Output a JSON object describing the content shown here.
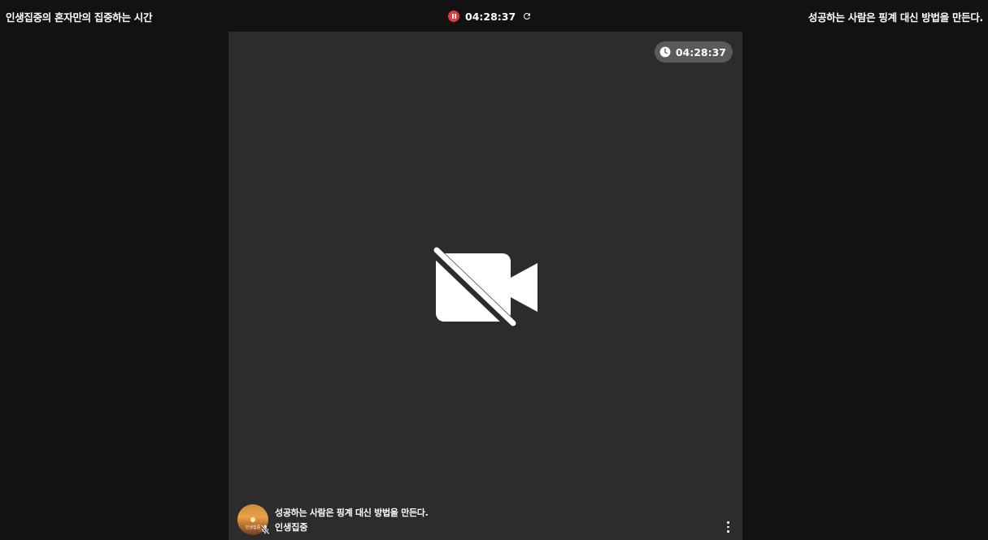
{
  "header": {
    "room_title": "인생집중의 혼자만의 집중하는 시간",
    "session_time": "04:28:37",
    "motto": "성공하는 사람은 핑계 대신 방법을 만든다."
  },
  "tile": {
    "time_badge": "04:28:37",
    "participant": {
      "status_message": "성공하는 사람은 핑계 대신 방법을 만든다.",
      "name": "인생집중",
      "avatar_text": "인생집중"
    }
  },
  "icons": {
    "pause": "pause-icon",
    "refresh": "refresh-icon",
    "clock": "clock-icon",
    "camera_off": "video-off-icon",
    "mic_off": "mic-off-icon",
    "more": "more-vertical-icon"
  },
  "colors": {
    "background": "#121212",
    "tile": "#2c2c2c",
    "record_red": "#e53935",
    "badge": "#5a5a5a"
  }
}
